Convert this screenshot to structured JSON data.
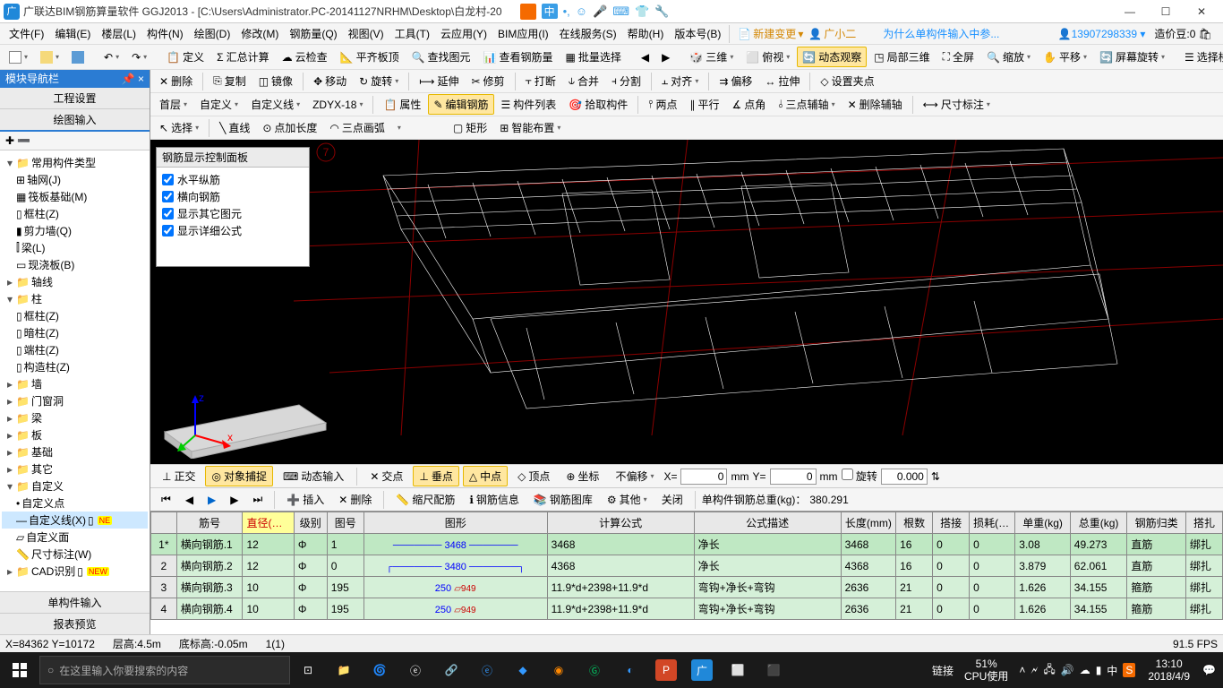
{
  "titlebar": {
    "app_icon_text": "广",
    "title": "广联达BIM钢筋算量软件 GGJ2013 - [C:\\Users\\Administrator.PC-20141127NRHM\\Desktop\\白龙村-20",
    "ime_cn": "中",
    "win_min": "—",
    "win_max": "☐",
    "win_close": "✕"
  },
  "menubar": {
    "items": [
      "文件(F)",
      "编辑(E)",
      "楼层(L)",
      "构件(N)",
      "绘图(D)",
      "修改(M)",
      "钢筋量(Q)",
      "视图(V)",
      "工具(T)",
      "云应用(Y)",
      "BIM应用(I)",
      "在线服务(S)",
      "帮助(H)",
      "版本号(B)"
    ],
    "new_change": "新建变更",
    "gxr": "广小二",
    "warn": "为什么单构件输入中参...",
    "account": "13907298339",
    "credits_label": "造价豆:",
    "credits_value": "0"
  },
  "tb1": {
    "items": [
      "定义",
      "汇总计算",
      "云检查",
      "平齐板顶",
      "查找图元",
      "查看钢筋量",
      "批量选择"
    ],
    "view": [
      "三维",
      "俯视",
      "动态观察",
      "局部三维",
      "全屏",
      "缩放",
      "平移",
      "屏幕旋转"
    ],
    "floor": "选择楼层"
  },
  "sidebar": {
    "title": "模块导航栏",
    "pin": "📌",
    "close": "×",
    "tabs": [
      "工程设置",
      "绘图输入"
    ],
    "tool_icons": "✚ ➖",
    "tree": {
      "root": "常用构件类型",
      "level1": [
        "轴网(J)",
        "筏板基础(M)",
        "框柱(Z)",
        "剪力墙(Q)",
        "梁(L)",
        "现浇板(B)"
      ],
      "groups": [
        "轴线",
        "柱",
        "墙",
        "门窗洞",
        "梁",
        "板",
        "基础",
        "其它",
        "自定义",
        "CAD识别"
      ],
      "zhu_children": [
        "框柱(Z)",
        "暗柱(Z)",
        "端柱(Z)",
        "构造柱(Z)"
      ],
      "zdy_children": [
        "自定义点",
        "自定义线(X)",
        "自定义面",
        "尺寸标注(W)"
      ]
    },
    "bottom_tabs": [
      "单构件输入",
      "报表预览"
    ]
  },
  "content_tb1": {
    "items": [
      "删除",
      "复制",
      "镜像",
      "移动",
      "旋转",
      "延伸",
      "修剪",
      "打断",
      "合并",
      "分割",
      "对齐",
      "偏移",
      "拉伸",
      "设置夹点"
    ]
  },
  "content_tb2": {
    "floor": "首层",
    "cat": "自定义",
    "type": "自定义线",
    "code": "ZDYX-18",
    "items": [
      "属性",
      "编辑钢筋",
      "构件列表",
      "拾取构件",
      "两点",
      "平行",
      "点角",
      "三点辅轴",
      "删除辅轴",
      "尺寸标注"
    ]
  },
  "content_tb3": {
    "items": [
      "选择",
      "直线",
      "点加长度",
      "三点画弧",
      "矩形",
      "智能布置"
    ]
  },
  "rebar_panel": {
    "title": "钢筋显示控制面板",
    "checks": [
      "水平纵筋",
      "横向钢筋",
      "显示其它图元",
      "显示详细公式"
    ]
  },
  "snapbar": {
    "items": [
      "正交",
      "对象捕捉",
      "动态输入",
      "交点",
      "垂点",
      "中点",
      "顶点",
      "坐标",
      "不偏移"
    ],
    "x_label": "X=",
    "x_val": "0",
    "x_unit": "mm",
    "y_label": "Y=",
    "y_val": "0",
    "y_unit": "mm",
    "rot_label": "旋转",
    "rot_val": "0.000"
  },
  "gridbar": {
    "items": [
      "插入",
      "删除",
      "缩尺配筋",
      "钢筋信息",
      "钢筋图库",
      "其他",
      "关闭"
    ],
    "total_label": "单构件钢筋总重(kg)：",
    "total_val": "380.291"
  },
  "grid": {
    "headers": [
      "",
      "筋号",
      "直径(mm)",
      "级别",
      "图号",
      "图形",
      "计算公式",
      "公式描述",
      "长度(mm)",
      "根数",
      "搭接",
      "损耗(%)",
      "单重(kg)",
      "总重(kg)",
      "钢筋归类",
      "搭扎"
    ],
    "rows": [
      {
        "n": "1*",
        "name": "横向钢筋.1",
        "dia": "12",
        "lvl": "Φ",
        "code": "1",
        "shape": "3468",
        "shape_type": "line",
        "calc": "3468",
        "desc": "净长",
        "len": "3468",
        "cnt": "16",
        "dj": "0",
        "loss": "0",
        "uw": "3.08",
        "tw": "49.273",
        "cat": "直筋",
        "tie": "绑扎"
      },
      {
        "n": "2",
        "name": "横向钢筋.2",
        "dia": "12",
        "lvl": "Φ",
        "code": "0",
        "shape": "3480",
        "shape_type": "hookline",
        "calc": "4368",
        "desc": "净长",
        "len": "4368",
        "cnt": "16",
        "dj": "0",
        "loss": "0",
        "uw": "3.879",
        "tw": "62.061",
        "cat": "直筋",
        "tie": "绑扎"
      },
      {
        "n": "3",
        "name": "横向钢筋.3",
        "dia": "10",
        "lvl": "Φ",
        "code": "195",
        "shape": "250 949",
        "shape_type": "hook",
        "calc": "11.9*d+2398+11.9*d",
        "desc": "弯钩+净长+弯钩",
        "len": "2636",
        "cnt": "21",
        "dj": "0",
        "loss": "0",
        "uw": "1.626",
        "tw": "34.155",
        "cat": "箍筋",
        "tie": "绑扎"
      },
      {
        "n": "4",
        "name": "横向钢筋.4",
        "dia": "10",
        "lvl": "Φ",
        "code": "195",
        "shape": "250 949",
        "shape_type": "hook",
        "calc": "11.9*d+2398+11.9*d",
        "desc": "弯钩+净长+弯钩",
        "len": "2636",
        "cnt": "21",
        "dj": "0",
        "loss": "0",
        "uw": "1.626",
        "tw": "34.155",
        "cat": "箍筋",
        "tie": "绑扎"
      }
    ]
  },
  "statusbar": {
    "coords": "X=84362 Y=10172",
    "floor_h": "层高:4.5m",
    "base_h": "底标高:-0.05m",
    "scale": "1(1)",
    "fps": "91.5 FPS"
  },
  "taskbar": {
    "search_placeholder": "在这里输入你要搜索的内容",
    "cpu_pct": "51%",
    "cpu_label": "CPU使用",
    "link": "链接",
    "ime": "中",
    "time": "13:10",
    "date": "2018/4/9"
  }
}
